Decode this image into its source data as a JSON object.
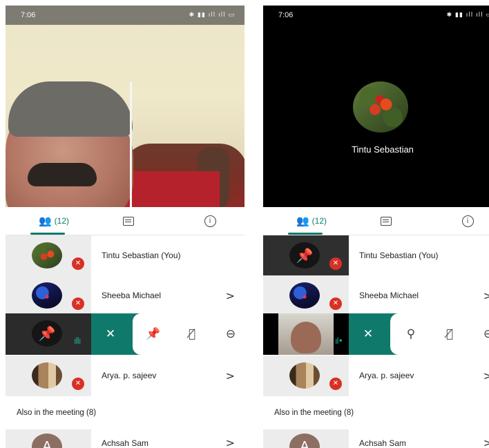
{
  "status": {
    "time": "7:06"
  },
  "panels": [
    {
      "call_name": "",
      "tabs": {
        "people_count": "(12)"
      },
      "participants": [
        {
          "name": "Tintu Sebastian (You)",
          "chevron": ""
        },
        {
          "name": "Sheeba Michael",
          "chevron": ">"
        },
        {
          "name": "Arya. p. sajeev",
          "chevron": ">"
        }
      ],
      "section_label": "Also in the meeting (8)",
      "extra": {
        "letter": "A",
        "name": "Achsah Sam",
        "chevron": ">"
      }
    },
    {
      "call_name": "Tintu Sebastian",
      "tabs": {
        "people_count": "(12)"
      },
      "participants": [
        {
          "name": "Tintu Sebastian (You)",
          "chevron": ""
        },
        {
          "name": "Sheeba Michael",
          "chevron": ">"
        },
        {
          "name": "Arya. p. sajeev",
          "chevron": ">"
        }
      ],
      "section_label": "Also in the meeting (8)",
      "extra": {
        "letter": "A",
        "name": "Achsah Sam",
        "chevron": ">"
      }
    }
  ],
  "colors": {
    "accent": "#0f7a6b",
    "mute_badge": "#d93025"
  }
}
